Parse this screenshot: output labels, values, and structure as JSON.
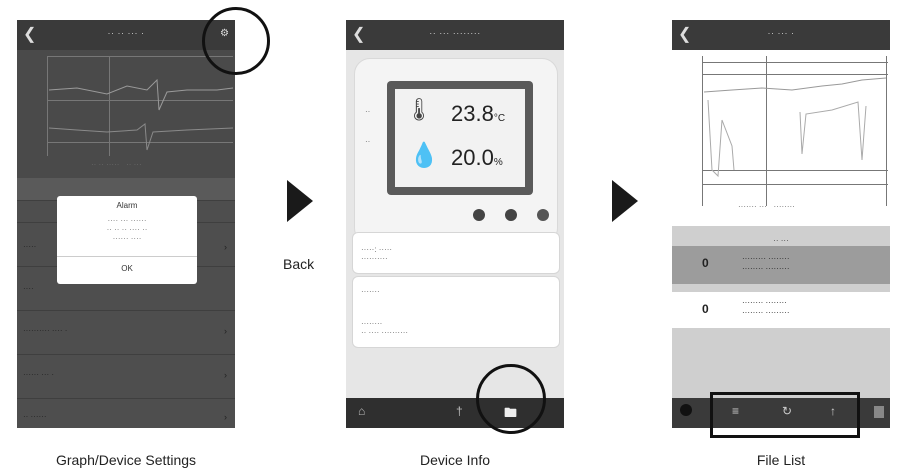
{
  "panel1": {
    "title": "Graph/Device Settings",
    "alarm_dialog": {
      "heading": "Alarm",
      "button": "OK"
    }
  },
  "panel2": {
    "title": "Device Info",
    "temperature": "23.8",
    "temperature_unit": "°C",
    "humidity": "20.0",
    "humidity_unit": "%"
  },
  "panel3": {
    "title": "File List"
  },
  "back_label": "Back"
}
